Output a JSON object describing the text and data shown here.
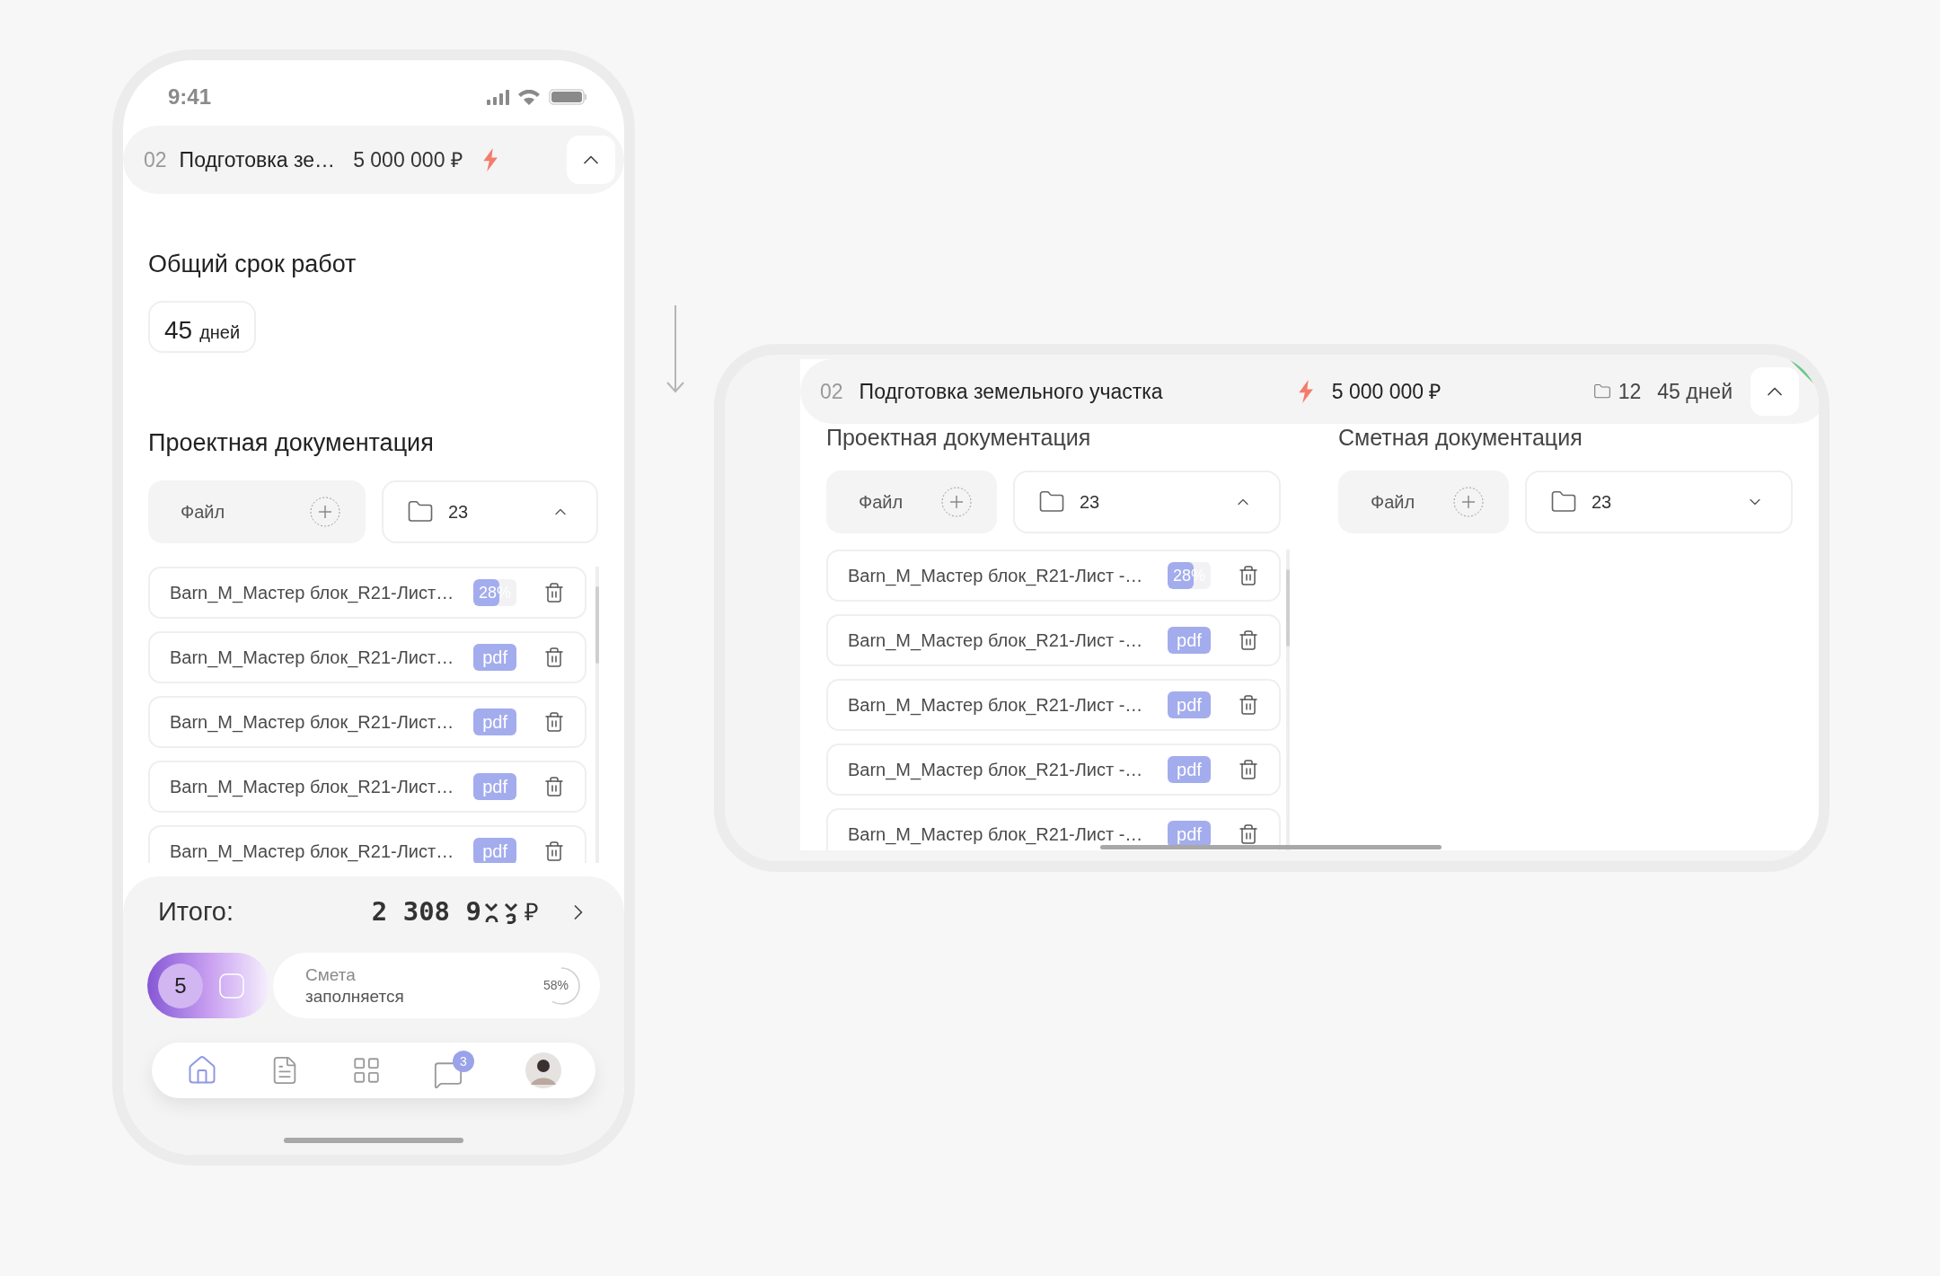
{
  "portrait": {
    "status_bar": {
      "time": "9:41"
    },
    "stage_header": {
      "number": "02",
      "title": "Подготовка зе…",
      "price": "5 000 000 ₽",
      "expanded": true
    },
    "duration": {
      "title": "Общий срок работ",
      "value": "45",
      "unit": "дней"
    },
    "section": {
      "title": "Проектная документация",
      "file_button": "Файл",
      "folder": {
        "count": "23",
        "expanded": true
      },
      "files": [
        {
          "name": "Barn_M_Мастер блок_R21-Лист…",
          "kind": "progress",
          "label": "28%",
          "level": 0.6
        },
        {
          "name": "Barn_M_Мастер блок_R21-Лист…",
          "kind": "pdf",
          "label": "pdf"
        },
        {
          "name": "Barn_M_Мастер блок_R21-Лист…",
          "kind": "pdf",
          "label": "pdf"
        },
        {
          "name": "Barn_M_Мастер блок_R21-Лист…",
          "kind": "pdf",
          "label": "pdf"
        },
        {
          "name": "Barn_M_Мастер блок_R21-Лист…",
          "kind": "pdf",
          "label": "pdf"
        }
      ]
    },
    "total": {
      "label": "Итого:",
      "amount": "2 308 9",
      "currency": "₽"
    },
    "estimate": {
      "count": "5",
      "label": "Смета",
      "status": "заполняется",
      "progress": "58%",
      "level": 0.58
    },
    "nav": [
      {
        "kind": "home",
        "selected": true
      },
      {
        "kind": "document",
        "selected": false
      },
      {
        "kind": "grid",
        "selected": false
      },
      {
        "kind": "chat",
        "selected": false,
        "badge": "3"
      },
      {
        "kind": "avatar",
        "selected": false
      }
    ]
  },
  "landscape": {
    "stage_header": {
      "number": "02",
      "title": "Подготовка земельного участка",
      "price": "5 000 000 ₽",
      "folder_count": "12",
      "duration": "45 дней",
      "expanded": true,
      "done": true
    },
    "columns": [
      {
        "title": "Проектная документация",
        "file_button": "Файл",
        "folder": {
          "count": "23",
          "expanded": true
        },
        "files": [
          {
            "name": "Barn_M_Мастер блок_R21-Лист -…",
            "kind": "progress",
            "label": "28%",
            "level": 0.6
          },
          {
            "name": "Barn_M_Мастер блок_R21-Лист -…",
            "kind": "pdf",
            "label": "pdf"
          },
          {
            "name": "Barn_M_Мастер блок_R21-Лист -…",
            "kind": "pdf",
            "label": "pdf"
          },
          {
            "name": "Barn_M_Мастер блок_R21-Лист -…",
            "kind": "pdf",
            "label": "pdf"
          },
          {
            "name": "Barn_M_Мастер блок_R21-Лист -…",
            "kind": "pdf",
            "label": "pdf"
          }
        ]
      },
      {
        "title": "Сметная документация",
        "file_button": "Файл",
        "folder": {
          "count": "23",
          "expanded": false
        }
      }
    ]
  }
}
